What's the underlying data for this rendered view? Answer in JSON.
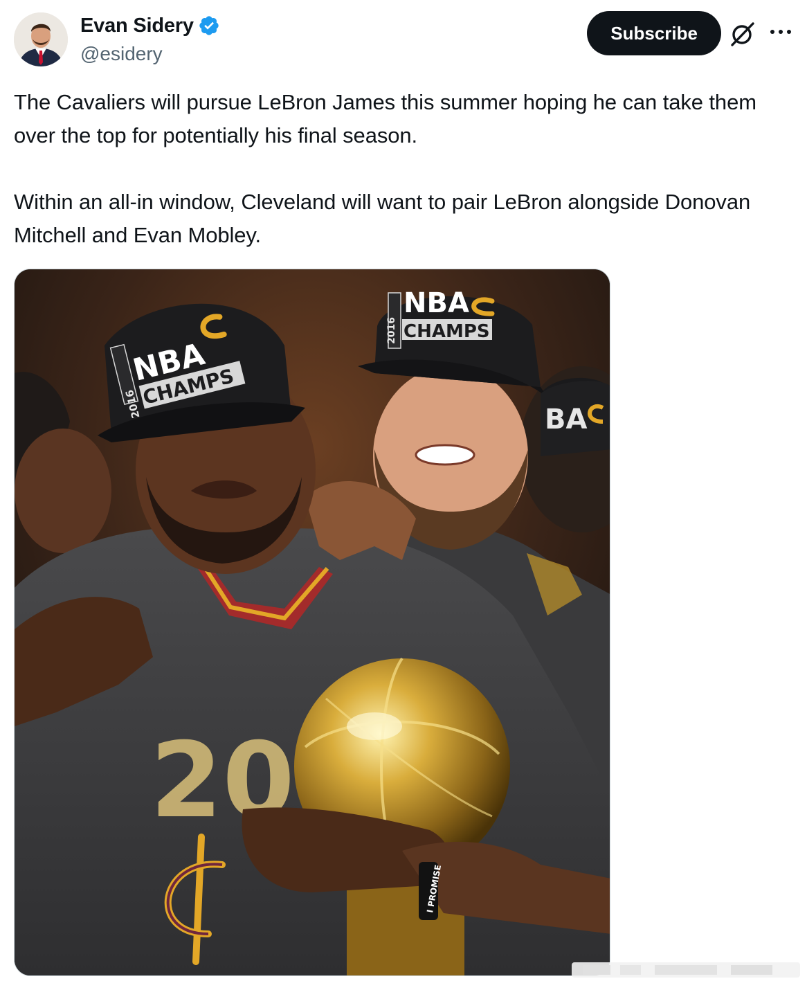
{
  "author": {
    "display_name": "Evan Sidery",
    "handle": "@esidery",
    "verified": true,
    "verified_color": "#1d9bf0"
  },
  "actions": {
    "subscribe_label": "Subscribe",
    "grok_icon": "grok-icon",
    "more_icon": "more-icon"
  },
  "tweet": {
    "text": "The Cavaliers will pursue LeBron James this summer hoping he can take them over the top for potentially his final season.\n\nWithin an all-in window, Cleveland will want to pair LeBron alongside Donovan Mitchell and Evan Mobley."
  },
  "media": {
    "image_text": {
      "cap_left_line1": "NBA",
      "cap_left_line2": "CHAMPS",
      "cap_left_year": "2016",
      "cap_right_line1": "NBA",
      "cap_right_line2": "CHAMPS",
      "cap_right_year": "2016",
      "cap_far_right": "BA",
      "jersey_number": "20",
      "wristband": "I PROMISE"
    }
  },
  "colors": {
    "text_primary": "#0f1419",
    "text_secondary": "#536471",
    "subscribe_bg": "#0f1419",
    "cavs_wine": "#6f263d",
    "cavs_gold": "#ffb81c"
  }
}
